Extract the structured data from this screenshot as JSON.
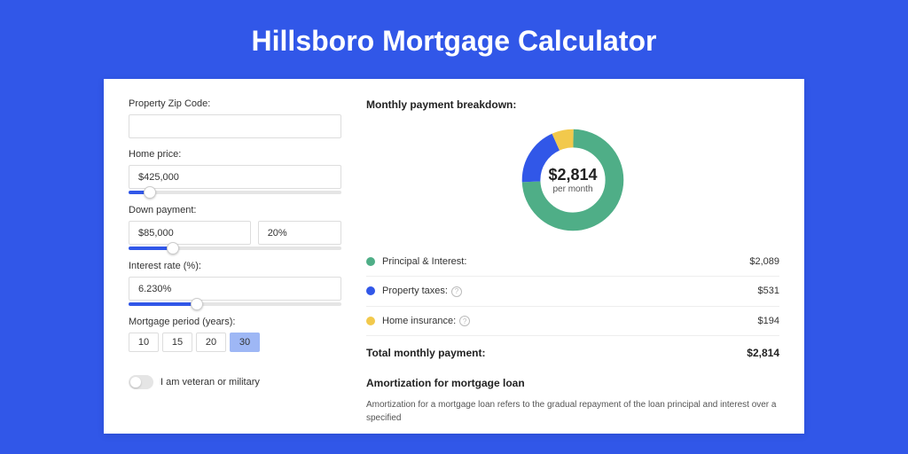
{
  "title": "Hillsboro Mortgage Calculator",
  "form": {
    "zip_label": "Property Zip Code:",
    "zip_value": "",
    "home_label": "Home price:",
    "home_value": "$425,000",
    "down_label": "Down payment:",
    "down_amount": "$85,000",
    "down_pct": "20%",
    "rate_label": "Interest rate (%):",
    "rate_value": "6.230%",
    "period_label": "Mortgage period (years):",
    "periods": [
      "10",
      "15",
      "20",
      "30"
    ],
    "period_selected": "30",
    "vet_label": "I am veteran or military"
  },
  "breakdown": {
    "title": "Monthly payment breakdown:",
    "center_value": "$2,814",
    "center_sub": "per month",
    "items": [
      {
        "label": "Principal & Interest:",
        "value": "$2,089"
      },
      {
        "label": "Property taxes:",
        "value": "$531"
      },
      {
        "label": "Home insurance:",
        "value": "$194"
      }
    ],
    "total_label": "Total monthly payment:",
    "total_value": "$2,814"
  },
  "amort": {
    "title": "Amortization for mortgage loan",
    "text": "Amortization for a mortgage loan refers to the gradual repayment of the loan principal and interest over a specified"
  },
  "chart_data": {
    "type": "pie",
    "title": "Monthly payment breakdown",
    "categories": [
      "Principal & Interest",
      "Property taxes",
      "Home insurance"
    ],
    "values": [
      2089,
      531,
      194
    ],
    "colors": [
      "#4fae87",
      "#3157e8",
      "#f2c94c"
    ],
    "center_label": "$2,814 per month"
  }
}
